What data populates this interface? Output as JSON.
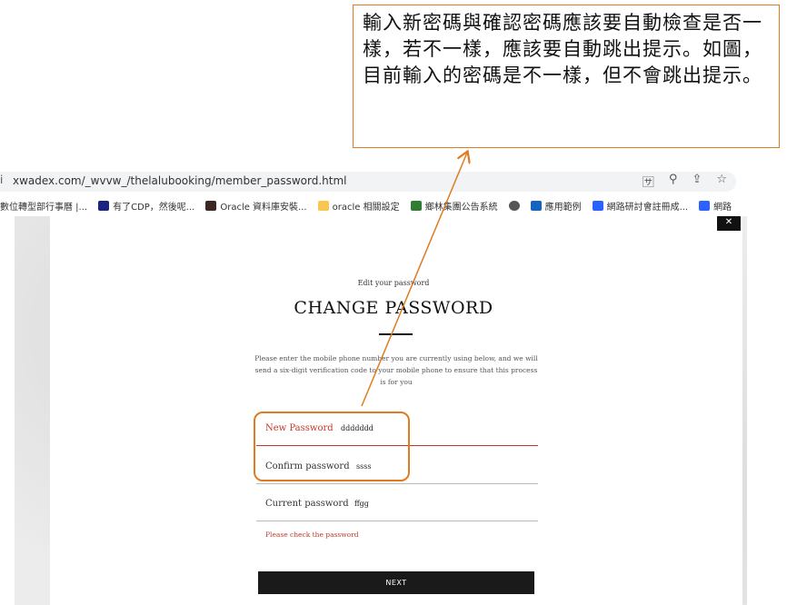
{
  "annotation": {
    "text": "輸入新密碼與確認密碼應該要自動檢查是否一樣，若不一樣，應該要自動跳出提示。如圖，目前輸入的密碼是不一樣，但不會跳出提示。"
  },
  "browser": {
    "url": "xwadex.com/_wvvw_/thelalubooking/member_password.html",
    "bookmarks": [
      {
        "label": "數位轉型部行事曆 |...",
        "icon_color": "#4285f4"
      },
      {
        "label": "有了CDP，然後呢...",
        "icon_color": "#1a237e"
      },
      {
        "label": "Oracle 資料庫安裝...",
        "icon_color": "#3e2723"
      },
      {
        "label": "oracle 相關設定",
        "icon_color": "#f9c74f"
      },
      {
        "label": "鄉林集團公告系統",
        "icon_color": "#2e7d32"
      },
      {
        "label": "",
        "icon_color": "#555555"
      },
      {
        "label": "應用範例",
        "icon_color": "#1565c0"
      },
      {
        "label": "網路研討會註冊成...",
        "icon_color": "#2962ff"
      },
      {
        "label": "網路",
        "icon_color": "#2962ff"
      }
    ]
  },
  "form": {
    "eyebrow": "Edit your password",
    "title": "CHANGE PASSWORD",
    "description": "Please enter the mobile phone number you are currently using below, and we will send a six-digit verification code to your mobile phone to ensure that this process is for you",
    "fields": [
      {
        "label": "New Password",
        "value": "ddddddd"
      },
      {
        "label": "Confirm password",
        "value": "ssss"
      },
      {
        "label": "Current password",
        "value": "ffgg"
      }
    ],
    "error_message": "Please check the password",
    "next_label": "NEXT"
  },
  "colors": {
    "annotation_border": "#e07b20",
    "error": "#c0392b",
    "button": "#1a1a1a"
  }
}
